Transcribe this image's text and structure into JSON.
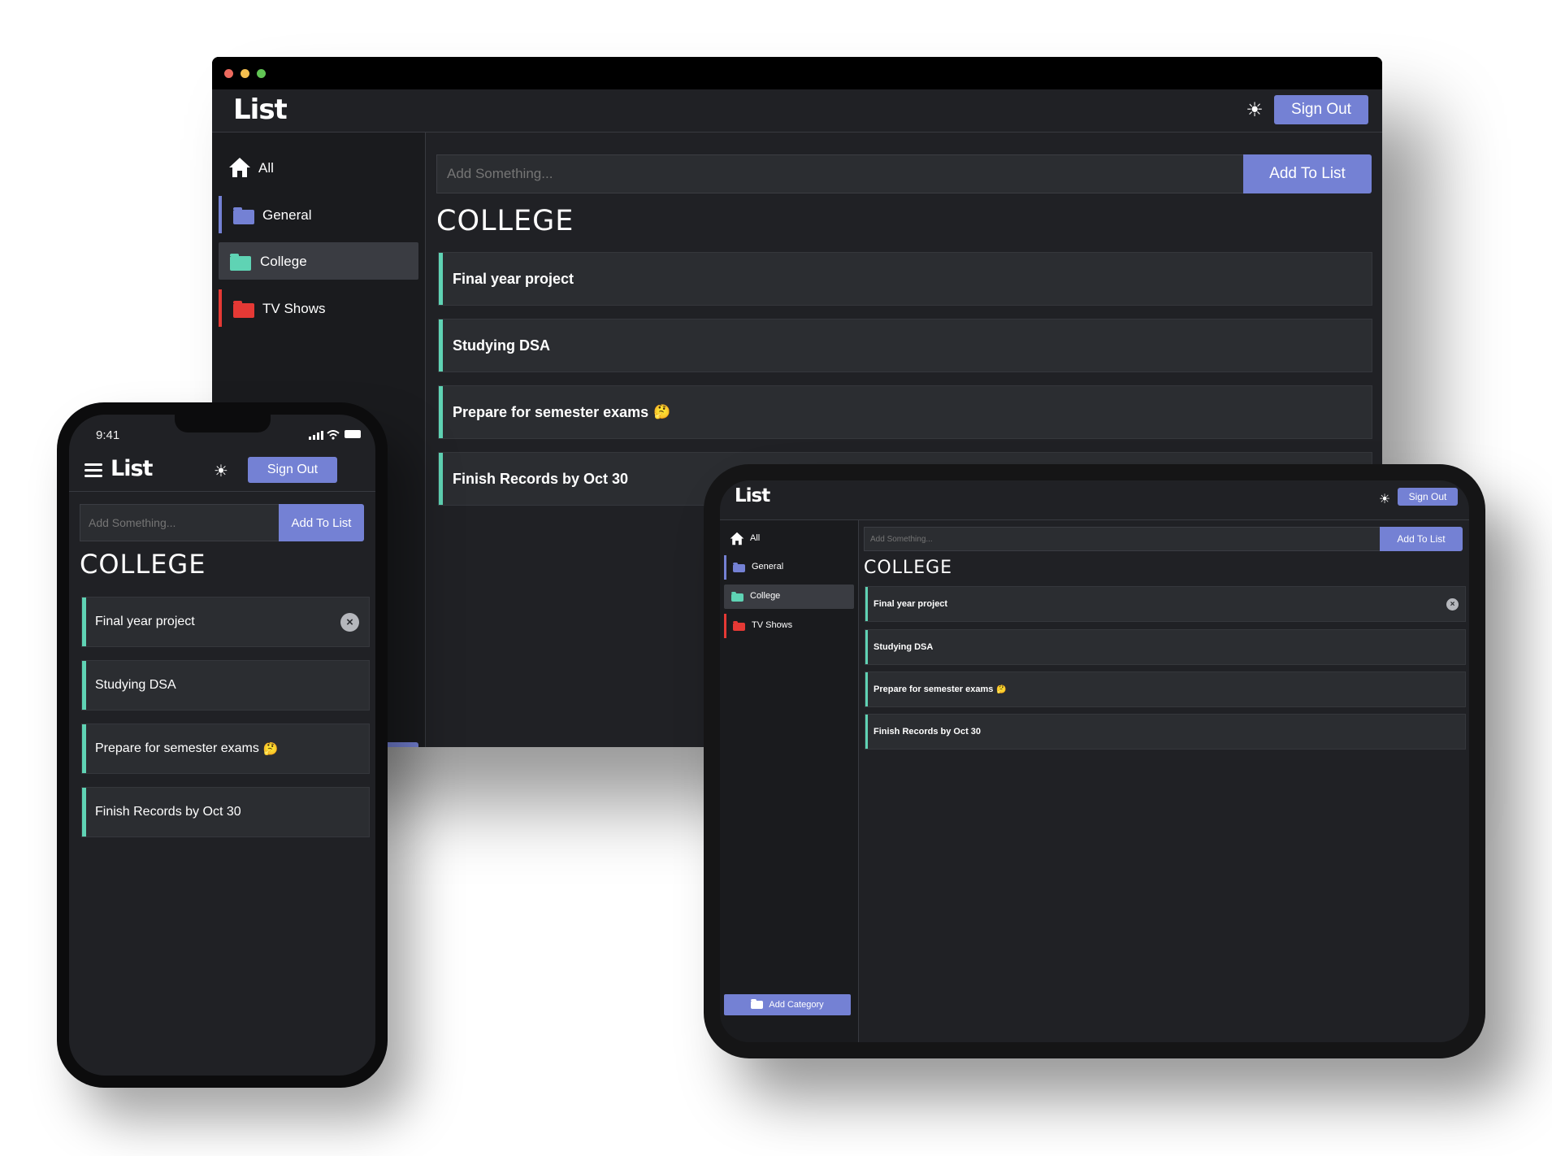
{
  "app": {
    "logo": "List"
  },
  "header": {
    "theme_icon": "☀",
    "signout_label": "Sign Out"
  },
  "sidebar": {
    "items": [
      {
        "label": "All",
        "icon": "home-icon",
        "color": "#ffffff"
      },
      {
        "label": "General",
        "icon": "folder-icon",
        "color": "#7481d4"
      },
      {
        "label": "College",
        "icon": "folder-icon",
        "color": "#5fd3b4",
        "active": true
      },
      {
        "label": "TV Shows",
        "icon": "folder-icon",
        "color": "#e53935"
      }
    ],
    "add_category_label": "Add Category"
  },
  "main": {
    "input_placeholder": "Add Something...",
    "add_button_label": "Add To List",
    "heading": "COLLEGE",
    "items": [
      {
        "text": "Final year project"
      },
      {
        "text": "Studying DSA"
      },
      {
        "text": "Prepare for semester exams",
        "emoji": "🤔"
      },
      {
        "text": "Finish Records by Oct 30"
      }
    ]
  },
  "phone": {
    "time": "9:41"
  },
  "colors": {
    "accent": "#7481d4",
    "college": "#5fd3b4",
    "general": "#7481d4",
    "tv_shows": "#e53935",
    "background": "#202125"
  }
}
